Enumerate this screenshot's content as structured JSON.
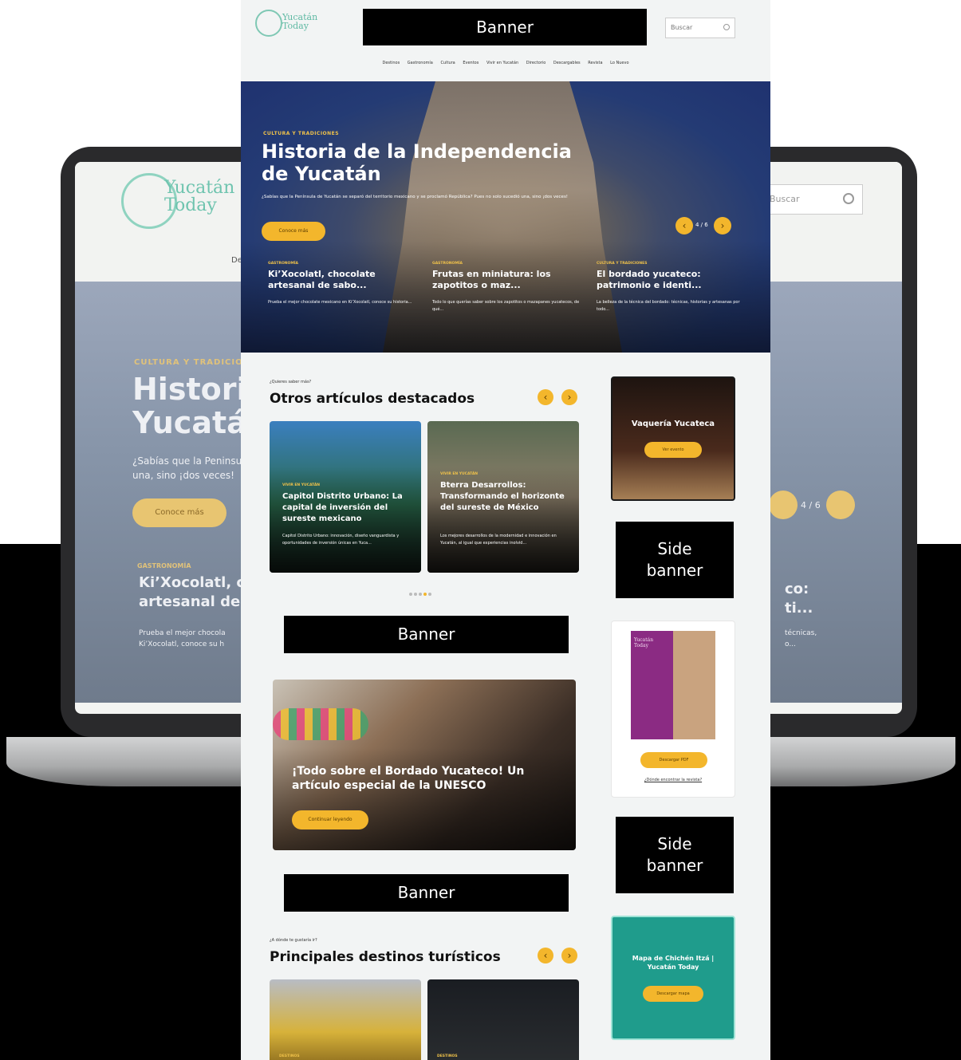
{
  "laptop": {
    "logo_line1": "Yucatán",
    "logo_line2": "Today",
    "search_placeholder": "Buscar",
    "nav_fragment": "Des",
    "hero_category": "CULTURA Y TRADICIONES",
    "hero_title_line1": "Historia",
    "hero_title_line2": "Yucatán",
    "hero_subtitle_line1": "¿Sabías que la Peninsu",
    "hero_subtitle_line2": "una, sino ¡dos veces!",
    "hero_button": "Conoce más",
    "card_category": "GASTRONOMÍA",
    "card_title_line1": "Ki’Xocolatl, ch",
    "card_title_line2": "artesanal de sa",
    "card_text_line1": "Prueba el mejor chocola",
    "card_text_line2": "Ki’Xocolatl, conoce su h",
    "slider_count": "4 / 6",
    "right_title_line1": "co:",
    "right_title_line2": "ti...",
    "right_text_line1": "técnicas,",
    "right_text_line2": "o..."
  },
  "page": {
    "logo_line1": "Yucatán",
    "logo_line2": "Today",
    "top_banner": "Banner",
    "search_placeholder": "Buscar",
    "nav": [
      "Destinos",
      "Gastronomía",
      "Cultura",
      "Eventos",
      "Vivir en Yucatán",
      "Directorio",
      "Descargables",
      "Revista",
      "Lo Nuevo"
    ],
    "hero": {
      "category": "CULTURA Y TRADICIONES",
      "title": "Historia de la Independencia de Yucatán",
      "subtitle": "¿Sabías que la Península de Yucatán se separó del territorio mexicano y se proclamó República? Pues no solo sucedió una, sino ¡dos veces!",
      "button": "Conoce más",
      "count": "4 / 6"
    },
    "hero_cards": [
      {
        "category": "GASTRONOMÍA",
        "title": "Ki’Xocolatl, chocolate artesanal de sabo...",
        "text": "Prueba el mejor chocolate mexicano en Ki’Xocolatl, conoce su historia..."
      },
      {
        "category": "GASTRONOMÍA",
        "title": "Frutas en miniatura: los zapotitos o maz...",
        "text": "Todo lo que querías saber sobre los zapotitos o mazapanes yucatecos, de qué..."
      },
      {
        "category": "CULTURA Y TRADICIONES",
        "title": "El bordado yucateco: patrimonio e identi...",
        "text": "La belleza de la técnica del bordado: técnicas, historias y artesanas por todo..."
      }
    ],
    "featured": {
      "kicker": "¿Quieres saber más?",
      "title": "Otros artículos destacados",
      "cards": [
        {
          "category": "VIVIR EN YUCATÁN",
          "title": "Capitol Distrito Urbano: La capital de inversión del sureste mexicano",
          "text": "Capitol Distrito Urbano: innovación, diseño vanguardista y oportunidades de inversión únicas en Yuca..."
        },
        {
          "category": "VIVIR EN YUCATÁN",
          "title": "Bterra Desarrollos: Transformando el horizonte del sureste de México",
          "text": "Los mejores desarrollos de la modernidad e innovación en Yucatán, al igual que experiencias inolvid..."
        }
      ]
    },
    "banner_middle": "Banner",
    "feature_article": {
      "title": "¡Todo sobre el Bordado Yucateco! Un artículo especial de la UNESCO",
      "button": "Continuar leyendo"
    },
    "banner_lower": "Banner",
    "destinations": {
      "kicker": "¿A dónde te gustaría ir?",
      "title": "Principales destinos turísticos",
      "cards": [
        {
          "category": "DESTINOS"
        },
        {
          "category": "DESTINOS"
        }
      ]
    },
    "sidebar": {
      "vaqueria_title": "Vaquería Yucateca",
      "vaqueria_button": "Ver evento",
      "side_banner_1_line1": "Side",
      "side_banner_1_line2": "banner",
      "guide_cover_line1": "Yucatán",
      "guide_cover_line2": "Today",
      "guide_button": "Descargar PDF",
      "guide_link": "¿Dónde encontrar la revista?",
      "side_banner_2_line1": "Side",
      "side_banner_2_line2": "banner",
      "map_title": "Mapa de Chichén Itzá | Yucatán Today",
      "map_button": "Descargar mapa"
    },
    "colors": {
      "accent": "#f3b62c",
      "brand_teal": "#5fb9a3",
      "hero_blue": "#243b74"
    }
  }
}
